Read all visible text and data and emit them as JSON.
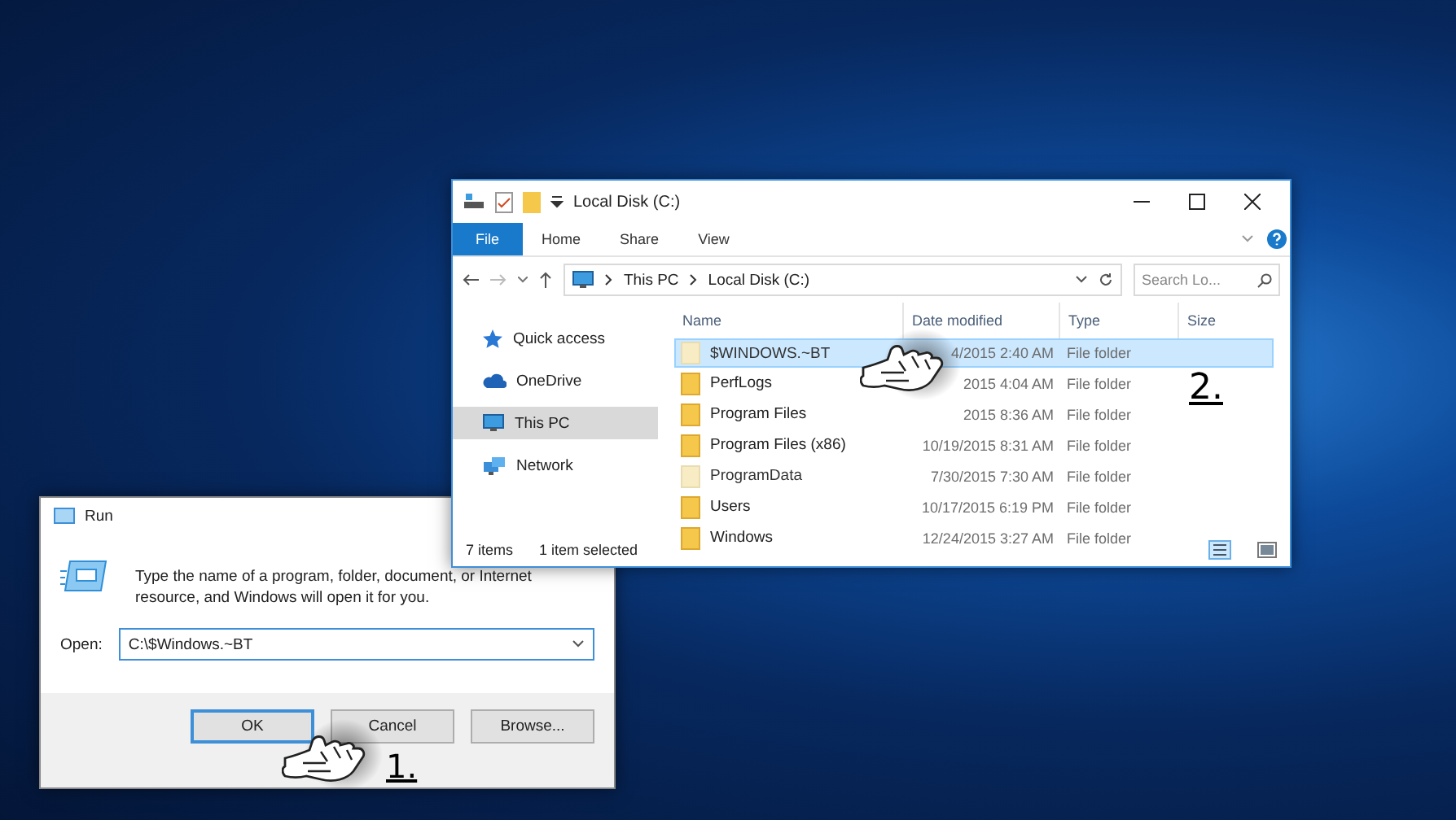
{
  "explorer": {
    "title": "Local Disk (C:)",
    "ribbon_tabs": [
      {
        "label": "File",
        "selected": true
      },
      {
        "label": "Home",
        "selected": false
      },
      {
        "label": "Share",
        "selected": false
      },
      {
        "label": "View",
        "selected": false
      }
    ],
    "address": [
      "This PC",
      "Local Disk (C:)"
    ],
    "search": {
      "placeholder": "Search Lo..."
    },
    "sidebar": {
      "items": [
        {
          "label": "Quick access",
          "selected": false
        },
        {
          "label": "OneDrive",
          "selected": false
        },
        {
          "label": "This PC",
          "selected": true
        },
        {
          "label": "Network",
          "selected": false
        }
      ]
    },
    "table": {
      "columns": [
        "Name",
        "Date modified",
        "Type",
        "Size"
      ],
      "rows": [
        {
          "name": "$WINDOWS.~BT",
          "date": "4/2015 2:40 AM",
          "type": "File folder",
          "selected": true,
          "hidden": true
        },
        {
          "name": "PerfLogs",
          "date": "2015 4:04 AM",
          "type": "File folder",
          "selected": false,
          "hidden": false
        },
        {
          "name": "Program Files",
          "date": "2015 8:36 AM",
          "type": "File folder",
          "selected": false,
          "hidden": false
        },
        {
          "name": "Program Files (x86)",
          "date": "10/19/2015 8:31 AM",
          "type": "File folder",
          "selected": false,
          "hidden": false
        },
        {
          "name": "ProgramData",
          "date": "7/30/2015 7:30 AM",
          "type": "File folder",
          "selected": false,
          "hidden": true
        },
        {
          "name": "Users",
          "date": "10/17/2015 6:19 PM",
          "type": "File folder",
          "selected": false,
          "hidden": false
        },
        {
          "name": "Windows",
          "date": "12/24/2015 3:27 AM",
          "type": "File folder",
          "selected": false,
          "hidden": false
        }
      ]
    },
    "status_bar": {
      "count": "7 items",
      "selection": "1 item selected"
    }
  },
  "run_dialog": {
    "title": "Run",
    "message": "Type the name of a program, folder, document, or Internet resource, and Windows will open it for you.",
    "open_label": "Open:",
    "value": "C:\\$Windows.~BT",
    "buttons": [
      {
        "label": "OK",
        "kind": "default"
      },
      {
        "label": "Cancel",
        "kind": "normal"
      },
      {
        "label": "Browse...",
        "kind": "normal"
      }
    ]
  },
  "annotations": [
    {
      "label": "1."
    },
    {
      "label": "2."
    }
  ]
}
